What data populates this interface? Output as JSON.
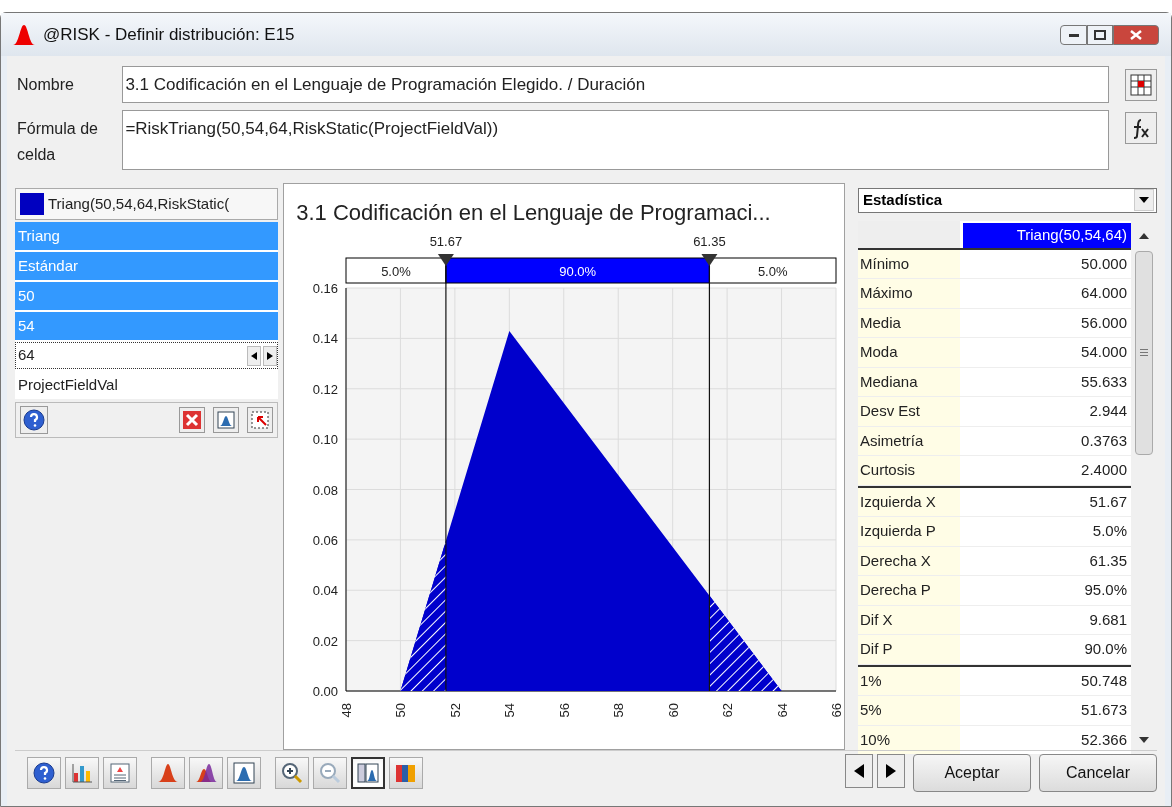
{
  "window": {
    "title": "@RISK - Definir distribución: E15"
  },
  "name_field": {
    "label": "Nombre",
    "value": "3.1 Codificación en el Lenguaje de Programación Elegido. / Duración"
  },
  "formula_field": {
    "label": "Fórmula de celda",
    "value": "=RiskTriang(50,54,64,RiskStatic(ProjectFieldVal))"
  },
  "parameters": {
    "header": "Triang(50,54,64,RiskStatic(",
    "color": "#0000c0",
    "rows": [
      {
        "text": "Triang",
        "kind": "text",
        "selected": true
      },
      {
        "text": "Estándar",
        "kind": "text",
        "selected": true
      },
      {
        "text": "50",
        "kind": "text",
        "selected": true
      },
      {
        "text": "54",
        "kind": "text",
        "selected": true
      },
      {
        "text": "64",
        "kind": "spinner",
        "selected": false
      },
      {
        "text": "ProjectFieldVal",
        "kind": "text",
        "selected": false
      }
    ]
  },
  "chart": {
    "markers": [
      {
        "label": "51.67"
      },
      {
        "label": "61.35"
      }
    ],
    "bands": [
      "5.0%",
      "90.0%",
      "5.0%"
    ],
    "chart_data": {
      "type": "area",
      "title": "3.1 Codificación en el Lenguaje de Programaci...",
      "x": [
        48,
        50,
        54,
        64,
        66
      ],
      "series": [
        {
          "color": "#0000cc",
          "values": [
            0,
            0,
            0.1429,
            0,
            0
          ]
        }
      ],
      "xlim": [
        48,
        66
      ],
      "ylim": [
        0,
        0.16
      ],
      "grid": true,
      "ref_lines": [
        {
          "axis": "x",
          "value": 51.67
        },
        {
          "axis": "x",
          "value": 61.35
        }
      ],
      "xticks": [
        48,
        50,
        52,
        54,
        56,
        58,
        60,
        62,
        64,
        66
      ],
      "yticks": [
        {
          "value": 0,
          "label": "0.00"
        },
        {
          "value": 0.02,
          "label": "0.02"
        },
        {
          "value": 0.04,
          "label": "0.04"
        },
        {
          "value": 0.06,
          "label": "0.06"
        },
        {
          "value": 0.08,
          "label": "0.08"
        },
        {
          "value": 0.1,
          "label": "0.10"
        },
        {
          "value": 0.12,
          "label": "0.12"
        },
        {
          "value": 0.14,
          "label": "0.14"
        },
        {
          "value": 0.16,
          "label": "0.16"
        }
      ]
    }
  },
  "statistics": {
    "dropdown": "Estadística",
    "column": "Triang(50,54,64)",
    "groups": [
      [
        {
          "label": "Mínimo",
          "value": "50.000"
        },
        {
          "label": "Máximo",
          "value": "64.000"
        },
        {
          "label": "Media",
          "value": "56.000"
        },
        {
          "label": "Moda",
          "value": "54.000"
        },
        {
          "label": "Mediana",
          "value": "55.633"
        },
        {
          "label": "Desv Est",
          "value": "2.944"
        },
        {
          "label": "Asimetría",
          "value": "0.3763"
        },
        {
          "label": "Curtosis",
          "value": "2.4000"
        }
      ],
      [
        {
          "label": "Izquierda X",
          "value": "51.67"
        },
        {
          "label": "Izquierda P",
          "value": "5.0%"
        },
        {
          "label": "Derecha X",
          "value": "61.35"
        },
        {
          "label": "Derecha P",
          "value": "95.0%"
        },
        {
          "label": "Dif X",
          "value": "9.681"
        },
        {
          "label": "Dif P",
          "value": "90.0%"
        }
      ],
      [
        {
          "label": "1%",
          "value": "50.748"
        },
        {
          "label": "5%",
          "value": "51.673"
        },
        {
          "label": "10%",
          "value": "52.366"
        }
      ]
    ]
  },
  "toolbar_groups": [
    [
      {
        "kind": "help",
        "pressed": false
      },
      {
        "kind": "bars",
        "pressed": false
      },
      {
        "kind": "report",
        "pressed": false
      }
    ],
    [
      {
        "kind": "dist",
        "pressed": false
      },
      {
        "kind": "overlay",
        "pressed": false
      },
      {
        "kind": "frame",
        "pressed": false
      }
    ],
    [
      {
        "kind": "zoomin",
        "pressed": false
      },
      {
        "kind": "zoomout",
        "pressed": false
      },
      {
        "kind": "layout",
        "pressed": true
      },
      {
        "kind": "books",
        "pressed": false
      }
    ]
  ],
  "buttons": [
    "Aceptar",
    "Cancelar"
  ]
}
